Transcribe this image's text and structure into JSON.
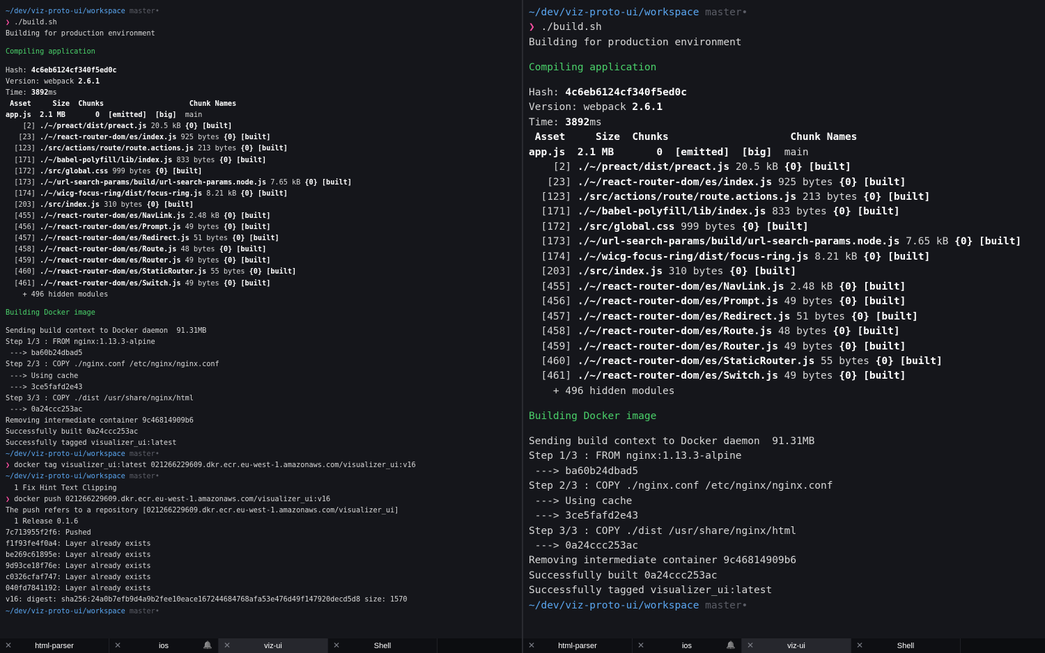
{
  "prompt_path": "~/dev/viz-proto-ui/workspace",
  "prompt_branch": "master•",
  "prompt_symbol": "❯",
  "left": {
    "cmd_build": "./build.sh",
    "building_for": "Building for production environment",
    "compiling": "Compiling application",
    "hash_label": "Hash: ",
    "hash_value": "4c6eb6124cf340f5ed0c",
    "version_label": "Version: webpack ",
    "version_value": "2.6.1",
    "time_label": "Time: ",
    "time_value": "3892",
    "time_unit": "ms",
    "table_header": " Asset     Size  Chunks                    Chunk Names",
    "asset_name": "app.js",
    "asset_size": "2.1 MB",
    "asset_chunks": "0",
    "asset_emitted": "[emitted]",
    "asset_big": "[big]",
    "asset_chunkname": "main",
    "modules": [
      {
        "id": "    [2]",
        "path": "./~/preact/dist/preact.js",
        "size": "20.5 kB",
        "chunk": "{0}",
        "status": "[built]"
      },
      {
        "id": "   [23]",
        "path": "./~/react-router-dom/es/index.js",
        "size": "925 bytes",
        "chunk": "{0}",
        "status": "[built]"
      },
      {
        "id": "  [123]",
        "path": "./src/actions/route/route.actions.js",
        "size": "213 bytes",
        "chunk": "{0}",
        "status": "[built]"
      },
      {
        "id": "  [171]",
        "path": "./~/babel-polyfill/lib/index.js",
        "size": "833 bytes",
        "chunk": "{0}",
        "status": "[built]"
      },
      {
        "id": "  [172]",
        "path": "./src/global.css",
        "size": "999 bytes",
        "chunk": "{0}",
        "status": "[built]"
      },
      {
        "id": "  [173]",
        "path": "./~/url-search-params/build/url-search-params.node.js",
        "size": "7.65 kB",
        "chunk": "{0}",
        "status": "[built]"
      },
      {
        "id": "  [174]",
        "path": "./~/wicg-focus-ring/dist/focus-ring.js",
        "size": "8.21 kB",
        "chunk": "{0}",
        "status": "[built]"
      },
      {
        "id": "  [203]",
        "path": "./src/index.js",
        "size": "310 bytes",
        "chunk": "{0}",
        "status": "[built]"
      },
      {
        "id": "  [455]",
        "path": "./~/react-router-dom/es/NavLink.js",
        "size": "2.48 kB",
        "chunk": "{0}",
        "status": "[built]"
      },
      {
        "id": "  [456]",
        "path": "./~/react-router-dom/es/Prompt.js",
        "size": "49 bytes",
        "chunk": "{0}",
        "status": "[built]"
      },
      {
        "id": "  [457]",
        "path": "./~/react-router-dom/es/Redirect.js",
        "size": "51 bytes",
        "chunk": "{0}",
        "status": "[built]"
      },
      {
        "id": "  [458]",
        "path": "./~/react-router-dom/es/Route.js",
        "size": "48 bytes",
        "chunk": "{0}",
        "status": "[built]"
      },
      {
        "id": "  [459]",
        "path": "./~/react-router-dom/es/Router.js",
        "size": "49 bytes",
        "chunk": "{0}",
        "status": "[built]"
      },
      {
        "id": "  [460]",
        "path": "./~/react-router-dom/es/StaticRouter.js",
        "size": "55 bytes",
        "chunk": "{0}",
        "status": "[built]"
      },
      {
        "id": "  [461]",
        "path": "./~/react-router-dom/es/Switch.js",
        "size": "49 bytes",
        "chunk": "{0}",
        "status": "[built]"
      }
    ],
    "hidden_modules": "    + 496 hidden modules",
    "building_docker": "Building Docker image",
    "docker_lines_1": [
      "Sending build context to Docker daemon  91.31MB",
      "Step 1/3 : FROM nginx:1.13.3-alpine",
      " ---> ba60b24dbad5",
      "Step 2/3 : COPY ./nginx.conf /etc/nginx/nginx.conf",
      " ---> Using cache",
      " ---> 3ce5fafd2e43",
      "Step 3/3 : COPY ./dist /usr/share/nginx/html",
      " ---> 0a24ccc253ac",
      "Removing intermediate container 9c46814909b6",
      "Successfully built 0a24ccc253ac",
      "Successfully tagged visualizer_ui:latest"
    ],
    "cmd_tag": "docker tag visualizer_ui:latest 021266229609.dkr.ecr.eu-west-1.amazonaws.com/visualizer_ui:v16",
    "fix_hint": "  1 Fix Hint Text Clipping",
    "cmd_push": "docker push 021266229609.dkr.ecr.eu-west-1.amazonaws.com/visualizer_ui:v16",
    "push_refers": "The push refers to a repository [021266229609.dkr.ecr.eu-west-1.amazonaws.com/visualizer_ui]",
    "release": "  1 Release 0.1.6",
    "push_lines": [
      "7c713955f2f6: Pushed",
      "f1f93fe4f0a4: Layer already exists",
      "be269c61895e: Layer already exists",
      "9d93ce18f76e: Layer already exists",
      "c0326cfaf747: Layer already exists",
      "040fd7841192: Layer already exists",
      "v16: digest: sha256:24a0b7efb9d4a9b2fee10eace167244684768afa53e476d49f147920decd5d8 size: 1570"
    ]
  },
  "tabs_left": [
    {
      "label": "html-parser",
      "active": false
    },
    {
      "label": "ios",
      "active": false
    },
    {
      "label": "viz-ui",
      "active": true
    },
    {
      "label": "Shell",
      "active": false
    }
  ],
  "tabs_right": [
    {
      "label": "html-parser",
      "active": false
    },
    {
      "label": "ios",
      "active": false
    },
    {
      "label": "viz-ui",
      "active": true
    },
    {
      "label": "Shell",
      "active": false
    }
  ],
  "close_symbol": "✕",
  "bell_symbol": "🔔"
}
